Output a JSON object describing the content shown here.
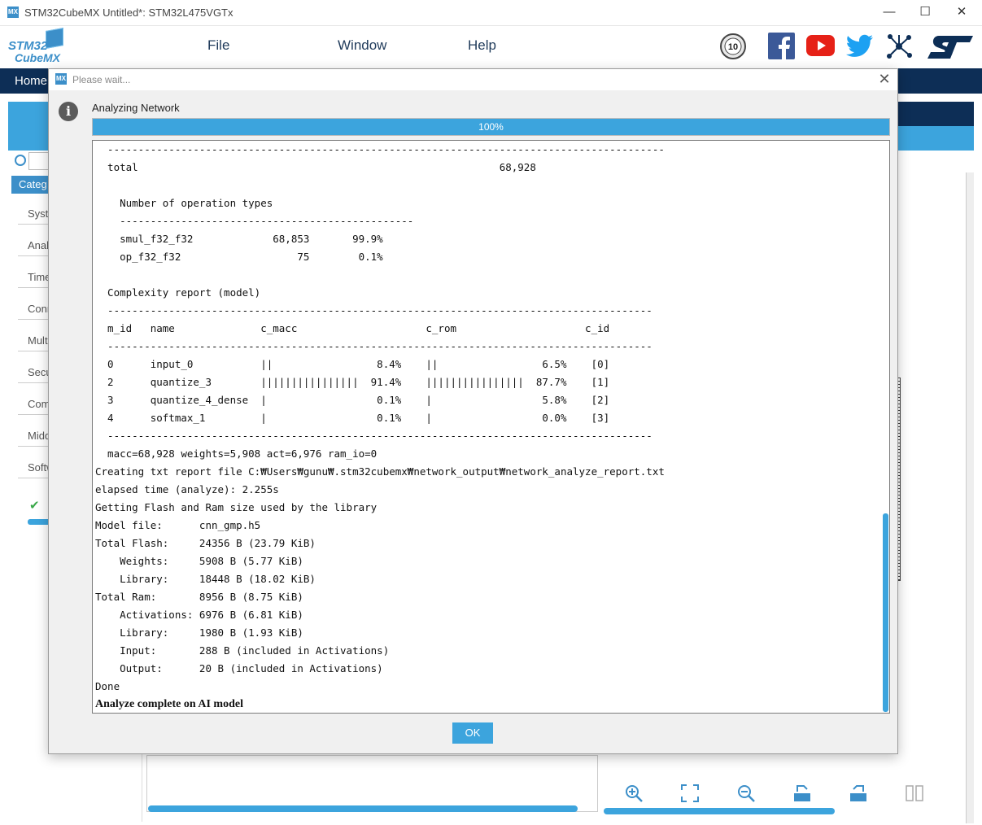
{
  "window": {
    "title": "STM32CubeMX Untitled*: STM32L475VGTx",
    "badge": "MX",
    "minimize": "—",
    "maximize": "☐",
    "close": "✕"
  },
  "logo": {
    "line1": "STM32",
    "line2": "CubeMX"
  },
  "menu": {
    "file": "File",
    "window": "Window",
    "help": "Help"
  },
  "social": {
    "anniversary_badge": "10",
    "brand_logo": "ST"
  },
  "nav": {
    "home": "Home"
  },
  "sidebar": {
    "category_header": "Categ",
    "items": [
      "Syst",
      "Anal",
      "Time",
      "Conn",
      "Mult",
      "Secu",
      "Com",
      "Midd",
      "Softw"
    ]
  },
  "toolbar_icons": [
    "zoom-in-icon",
    "fit-screen-icon",
    "zoom-out-icon",
    "export-icon",
    "import-icon",
    "split-view-icon"
  ],
  "dialog": {
    "badge": "MX",
    "title": "Please wait...",
    "close": "✕",
    "status": "Analyzing Network",
    "progress_percent": 100,
    "progress_label": "100%",
    "ok_label": "OK",
    "log_lines": [
      "  -------------------------------------------------------------------------------------------",
      "  total                                                           68,928",
      "",
      "    Number of operation types",
      "    ------------------------------------------------",
      "    smul_f32_f32             68,853       99.9%",
      "    op_f32_f32                   75        0.1%",
      "",
      "  Complexity report (model)",
      "  -----------------------------------------------------------------------------------------",
      "  m_id   name              c_macc                     c_rom                     c_id",
      "  -----------------------------------------------------------------------------------------",
      "  0      input_0           ||                 8.4%    ||                 6.5%    [0]",
      "  2      quantize_3        ||||||||||||||||  91.4%    ||||||||||||||||  87.7%    [1]",
      "  3      quantize_4_dense  |                  0.1%    |                  5.8%    [2]",
      "  4      softmax_1         |                  0.1%    |                  0.0%    [3]",
      "  -----------------------------------------------------------------------------------------",
      "  macc=68,928 weights=5,908 act=6,976 ram_io=0",
      "Creating txt report file C:₩Users₩gunu₩.stm32cubemx₩network_output₩network_analyze_report.txt",
      "elapsed time (analyze): 2.255s",
      "Getting Flash and Ram size used by the library",
      "Model file:      cnn_gmp.h5",
      "Total Flash:     24356 B (23.79 KiB)",
      "    Weights:     5908 B (5.77 KiB)",
      "    Library:     18448 B (18.02 KiB)",
      "Total Ram:       8956 B (8.75 KiB)",
      "    Activations: 6976 B (6.81 KiB)",
      "    Library:     1980 B (1.93 KiB)",
      "    Input:       288 B (included in Activations)",
      "    Output:      20 B (included in Activations)",
      "Done"
    ],
    "final_line": "Analyze complete on AI model"
  },
  "colors": {
    "accent": "#3ca4dd",
    "navy": "#0d2e56",
    "mx_badge": "#3c8fc9"
  }
}
